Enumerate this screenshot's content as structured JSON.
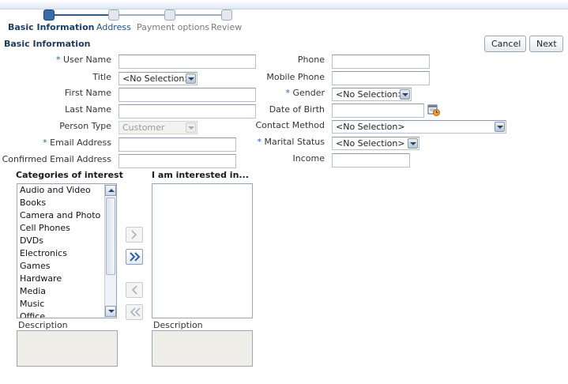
{
  "train": {
    "steps": [
      {
        "label": "Basic Information",
        "state": "active"
      },
      {
        "label": "Address",
        "state": "link"
      },
      {
        "label": "Payment options",
        "state": "disabled"
      },
      {
        "label": "Review",
        "state": "disabled"
      }
    ]
  },
  "header": {
    "section_title": "Basic Information",
    "cancel_label": "Cancel",
    "next_label": "Next"
  },
  "form": {
    "required_marker": "*",
    "user_name_label": "User Name",
    "user_name_value": "",
    "title_label": "Title",
    "title_value": "<No Selection>",
    "first_name_label": "First Name",
    "first_name_value": "",
    "last_name_label": "Last Name",
    "last_name_value": "",
    "person_type_label": "Person Type",
    "person_type_value": "Customer",
    "email_label": "Email Address",
    "email_value": "",
    "confirm_email_label": "Confirmed Email Address",
    "confirm_email_value": "",
    "phone_label": "Phone",
    "phone_value": "",
    "mobile_label": "Mobile Phone",
    "mobile_value": "",
    "gender_label": "Gender",
    "gender_value": "<No Selection>",
    "dob_label": "Date of Birth",
    "dob_value": "",
    "contact_method_label": "Contact Method",
    "contact_method_value": "<No Selection>",
    "marital_status_label": "Marital Status",
    "marital_status_value": "<No Selection>",
    "income_label": "Income",
    "income_value": ""
  },
  "shuttle": {
    "left_heading": "Categories of interest",
    "right_heading": "I am interested in...",
    "left_items": [
      "Audio and Video",
      "Books",
      "Camera and Photo",
      "Cell Phones",
      "DVDs",
      "Electronics",
      "Games",
      "Hardware",
      "Media",
      "Music",
      "Office"
    ],
    "right_items": [],
    "left_description_label": "Description",
    "right_description_label": "Description"
  },
  "colors": {
    "accent": "#2f5a8c",
    "required": "#2b64a6",
    "description_bg": "#efede7"
  }
}
